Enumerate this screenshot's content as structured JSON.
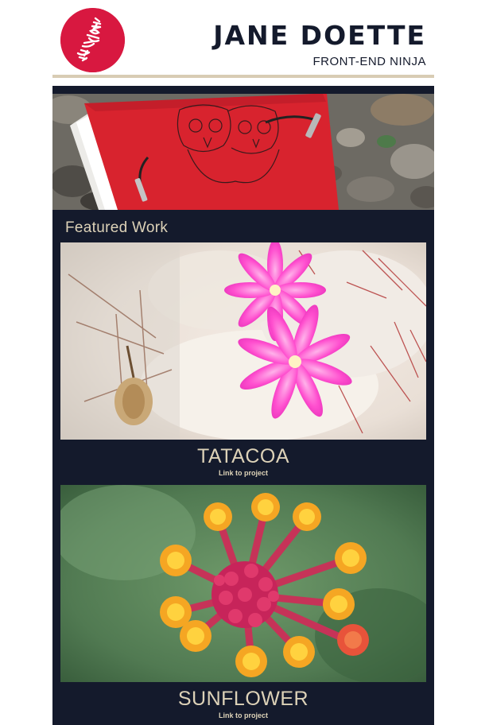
{
  "header": {
    "title": "JANE DOETTE",
    "subtitle": "FRONT-END NINJA",
    "logo_icon": "scribble-logo-icon"
  },
  "hero": {
    "image_subject": "red notebook with owl drawing"
  },
  "featured": {
    "heading": "Featured Work",
    "projects": [
      {
        "title": "TATACOA",
        "link_label": "Link to project"
      },
      {
        "title": "SUNFLOWER",
        "link_label": "Link to project"
      }
    ]
  },
  "colors": {
    "accent": "#d81840",
    "dark_panel": "#141a2c",
    "cream_text": "#ddd2b8",
    "rule": "#d8ccb4"
  }
}
